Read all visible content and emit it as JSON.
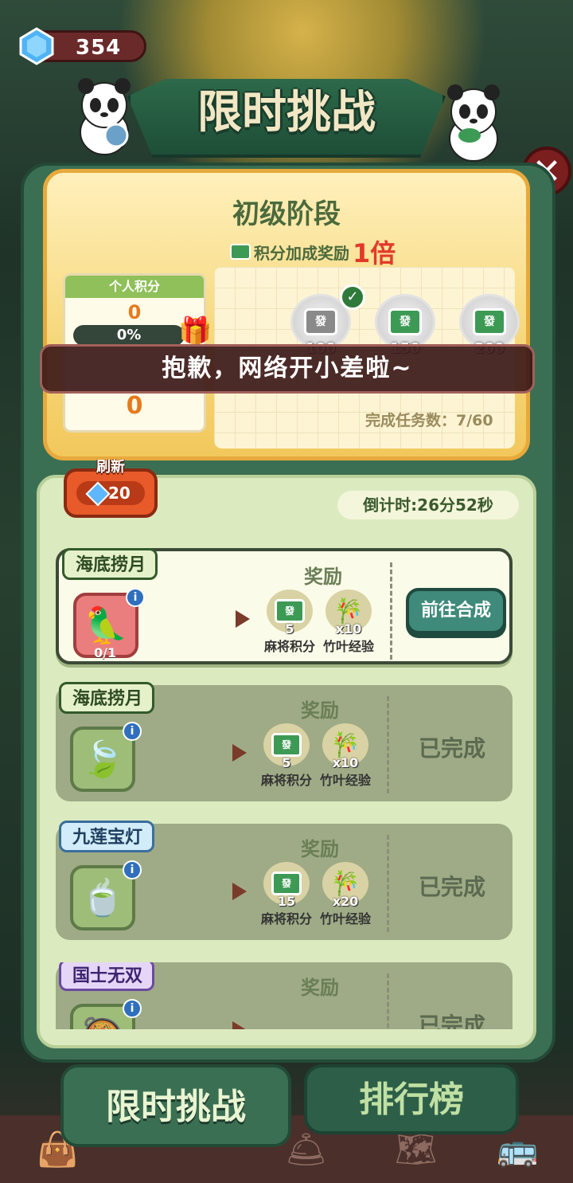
{
  "currency": {
    "gems": "354"
  },
  "header": {
    "title": "限时挑战"
  },
  "stage": {
    "name": "初级阶段",
    "bonus_text": "积分加成奖励",
    "bonus_multiplier": "1倍"
  },
  "personal": {
    "title": "个人积分",
    "score": "0",
    "progress": "0%",
    "rank_score": "0"
  },
  "milestones": [
    {
      "value": "100",
      "tile": "發",
      "claimed": true
    },
    {
      "value": "150",
      "tile": "發",
      "claimed": false
    },
    {
      "value": "200",
      "tile": "發",
      "claimed": false
    }
  ],
  "tasks_done": "完成任务数：7/60",
  "toast": "抱歉，网络开小差啦~",
  "refresh": {
    "label": "刷新",
    "cost": "20"
  },
  "countdown": "倒计时:26分52秒",
  "reward_label": "奖励",
  "tasks": [
    {
      "tag": "海底捞月",
      "progress": "0/1",
      "reward1_qty": "5",
      "reward1_name": "麻将积分",
      "reward2_qty": "x10",
      "reward2_name": "竹叶经验",
      "action": "前往合成"
    },
    {
      "tag": "海底捞月",
      "reward1_qty": "5",
      "reward1_name": "麻将积分",
      "reward2_qty": "x10",
      "reward2_name": "竹叶经验",
      "status": "已完成"
    },
    {
      "tag": "九莲宝灯",
      "reward1_qty": "15",
      "reward1_name": "麻将积分",
      "reward2_qty": "x20",
      "reward2_name": "竹叶经验",
      "status": "已完成"
    },
    {
      "tag": "国士无双",
      "status": "已完成"
    }
  ],
  "tabs": {
    "challenge": "限时挑战",
    "ranking": "排行榜"
  },
  "colors": {
    "accent": "#3b6f53",
    "highlight": "#e23a2a",
    "toast_bg": "#3c1919"
  }
}
